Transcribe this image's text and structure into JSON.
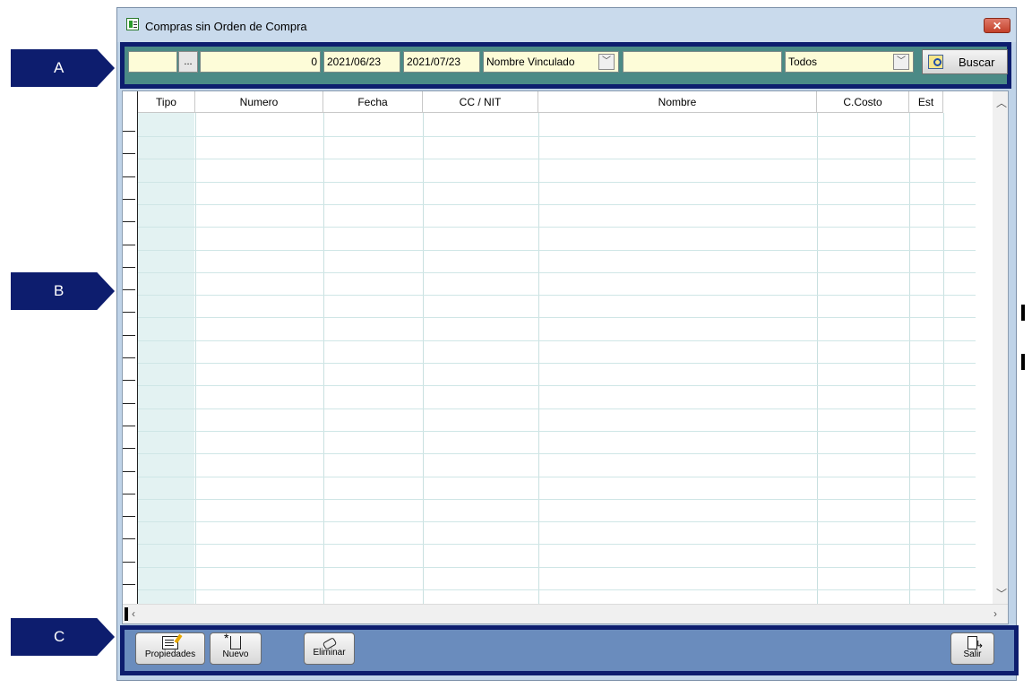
{
  "callouts": [
    "A",
    "B",
    "C"
  ],
  "window": {
    "title": "Compras sin Orden de Compra",
    "close_glyph": "✕"
  },
  "filter_bar": {
    "code_value": "",
    "browse_label": "...",
    "number_value": "0",
    "date_from": "2021/06/23",
    "date_to": "2021/07/23",
    "name_type_selected": "Nombre Vinculado",
    "name_value": "",
    "status_selected": "Todos",
    "search_button": "Buscar"
  },
  "grid": {
    "columns": [
      "Tipo",
      "Numero",
      "Fecha",
      "CC / NIT",
      "Nombre",
      "C.Costo",
      "Est"
    ],
    "rows": []
  },
  "bottom_bar": {
    "properties_label": "Propiedades",
    "new_label": "Nuevo",
    "delete_label": "Eliminar",
    "exit_label": "Salir"
  },
  "icons": {
    "window": "app-window-icon",
    "close": "close-icon",
    "search": "search-icon",
    "dropdown": "chevron-down-icon",
    "properties": "edit-icon",
    "new": "new-document-icon",
    "delete": "eraser-icon",
    "exit": "exit-door-icon"
  },
  "colors": {
    "callout": "#0d1d6e",
    "filter_background": "#4b8a86",
    "input_background": "#fdfcd8",
    "bottom_bar_background": "#6a8cbd",
    "grid_tipo_column": "#e3f2f2"
  }
}
